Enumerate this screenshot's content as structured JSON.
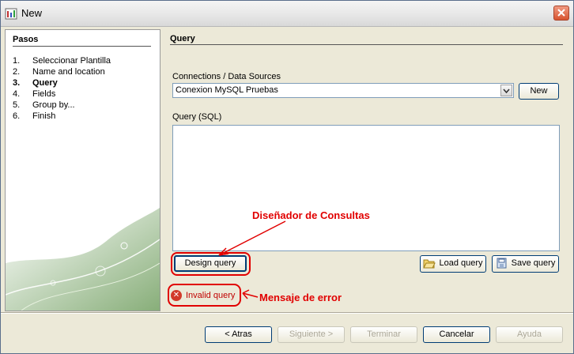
{
  "window": {
    "title": "New"
  },
  "steps": {
    "heading": "Pasos",
    "items": [
      {
        "num": "1.",
        "label": "Seleccionar Plantilla"
      },
      {
        "num": "2.",
        "label": "Name and location"
      },
      {
        "num": "3.",
        "label": "Query",
        "current": true
      },
      {
        "num": "4.",
        "label": "Fields"
      },
      {
        "num": "5.",
        "label": "Group by..."
      },
      {
        "num": "6.",
        "label": "Finish"
      }
    ]
  },
  "main": {
    "title": "Query",
    "connections_label": "Connections / Data Sources",
    "connection_value": "Conexion MySQL Pruebas",
    "new_label": "New",
    "query_label": "Query (SQL)",
    "query_value": "",
    "design_label": "Design query",
    "load_label": "Load query",
    "save_label": "Save query",
    "error_text": "Invalid query"
  },
  "annotations": {
    "designer": "Diseñador de Consultas",
    "error": "Mensaje de error",
    "color": "#e10000"
  },
  "footer": {
    "back": "< Atras",
    "next": "Siguiente >",
    "finish": "Terminar",
    "cancel": "Cancelar",
    "help": "Ayuda"
  }
}
